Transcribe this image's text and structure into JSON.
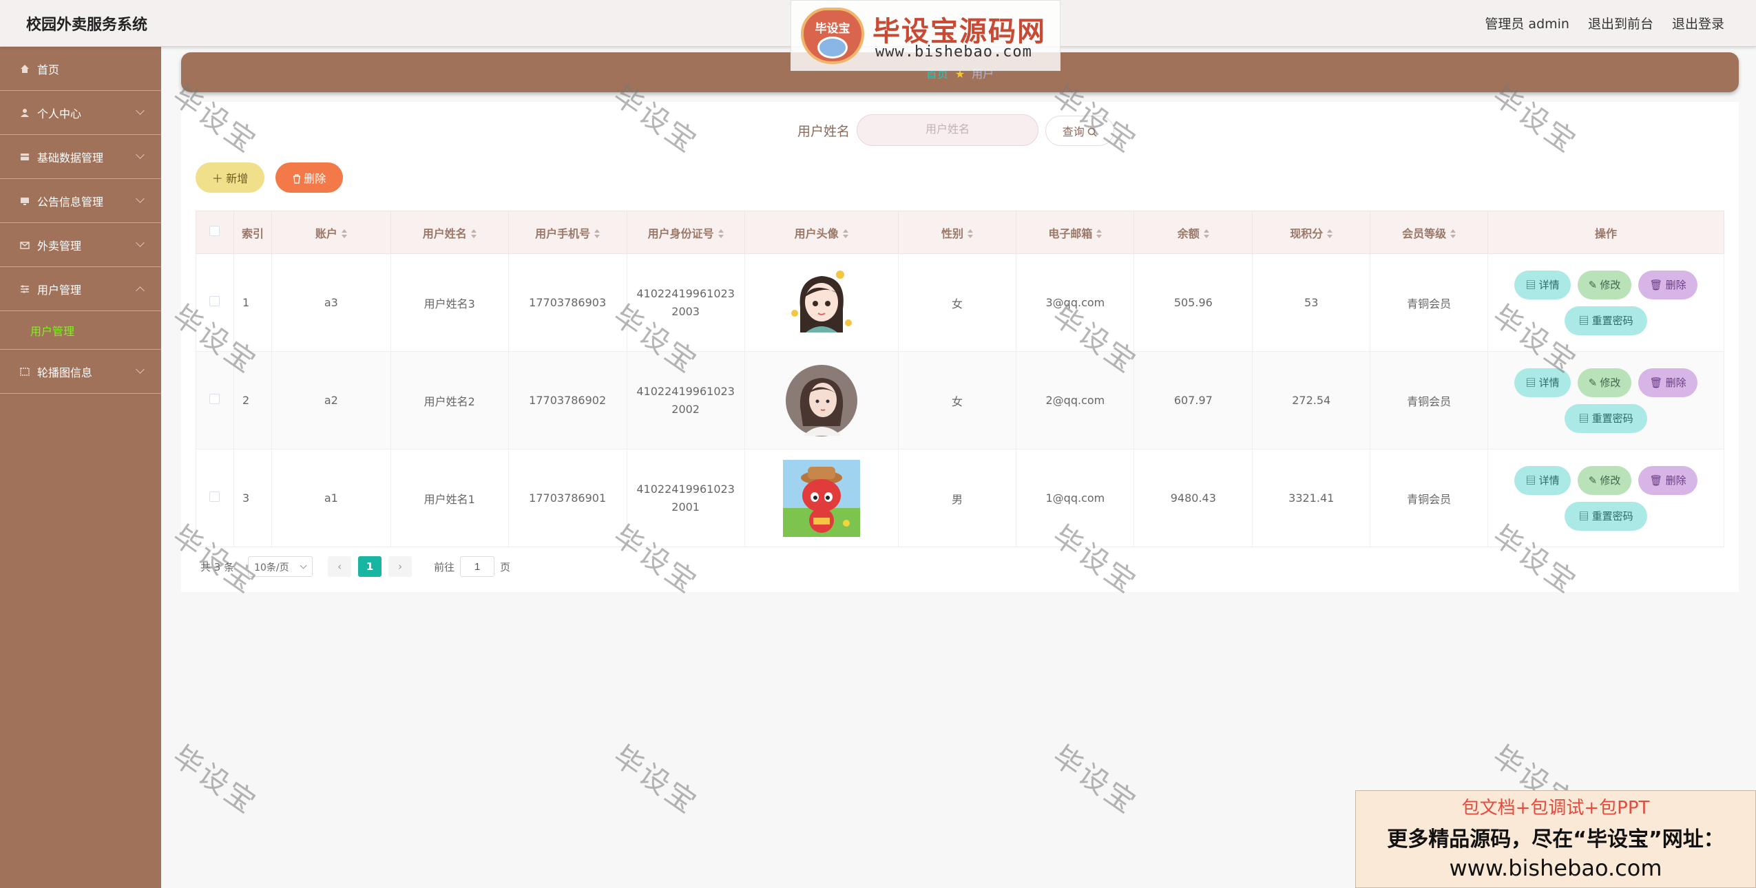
{
  "app": {
    "title": "校园外卖服务系统"
  },
  "topbar": {
    "user": "管理员 admin",
    "to_front": "退出到前台",
    "logout": "退出登录"
  },
  "watermark": {
    "badge": "毕设宝",
    "cn": "毕设宝源码网",
    "url": "www.bishebao.com",
    "diag": "毕设宝"
  },
  "sidebar": {
    "items": [
      {
        "label": "首页",
        "icon": "home-icon"
      },
      {
        "label": "个人中心",
        "icon": "user-icon"
      },
      {
        "label": "基础数据管理",
        "icon": "data-icon"
      },
      {
        "label": "公告信息管理",
        "icon": "notice-icon"
      },
      {
        "label": "外卖管理",
        "icon": "takeout-icon"
      },
      {
        "label": "用户管理",
        "icon": "users-icon"
      }
    ],
    "active_sub": "用户管理",
    "last_item": {
      "label": "轮播图信息",
      "icon": "image-icon"
    }
  },
  "breadcrumb": {
    "home": "首页",
    "current": "用户"
  },
  "search": {
    "label": "用户姓名",
    "placeholder": "用户姓名",
    "button": "查询"
  },
  "actions": {
    "add": "新增",
    "delete": "删除"
  },
  "table": {
    "headers": [
      "索引",
      "账户",
      "用户姓名",
      "用户手机号",
      "用户身份证号",
      "用户头像",
      "性别",
      "电子邮箱",
      "余额",
      "现积分",
      "会员等级",
      "操作"
    ],
    "rows": [
      {
        "index": "1",
        "account": "a3",
        "name": "用户姓名3",
        "phone": "17703786903",
        "id_card": "410224199610232003",
        "gender": "女",
        "email": "3@qq.com",
        "balance": "505.96",
        "points": "53",
        "level": "青铜会员"
      },
      {
        "index": "2",
        "account": "a2",
        "name": "用户姓名2",
        "phone": "17703786902",
        "id_card": "410224199610232002",
        "gender": "女",
        "email": "2@qq.com",
        "balance": "607.97",
        "points": "272.54",
        "level": "青铜会员"
      },
      {
        "index": "3",
        "account": "a1",
        "name": "用户姓名1",
        "phone": "17703786901",
        "id_card": "410224199610232001",
        "gender": "男",
        "email": "1@qq.com",
        "balance": "9480.43",
        "points": "3321.41",
        "level": "青铜会员"
      }
    ],
    "ops": {
      "detail": "详情",
      "edit": "修改",
      "remove": "删除",
      "reset": "重置密码"
    }
  },
  "pager": {
    "total": "共 3 条",
    "page_size": "10条/页",
    "current": "1",
    "goto_label": "前往",
    "goto_value": "1",
    "page_unit": "页"
  },
  "ad": {
    "line1": "包文档+包调试+包PPT",
    "line2": "更多精品源码，尽在“毕设宝”网址：",
    "line3": "www.bishebao.com"
  },
  "colors": {
    "brand": "#a1725a",
    "accent": "#19b5a3",
    "submenu_active": "#7ff21e"
  }
}
